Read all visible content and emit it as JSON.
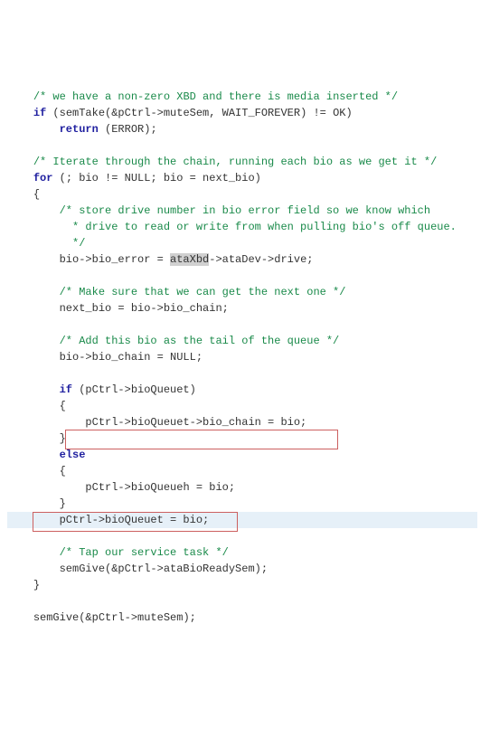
{
  "code": {
    "l1": "/* we have a non-zero XBD and there is media inserted */",
    "l2a": "if",
    "l2b": " (semTake(&pCtrl->muteSem, WAIT_FOREVER) != OK)",
    "l3a": "return",
    "l3b": " (ERROR);",
    "l4": "/* Iterate through the chain, running each bio as we get it */",
    "l5a": "for",
    "l5b": " (; bio != NULL; bio = next_bio)",
    "l6": "{",
    "l7": "/* store drive number in bio error field so we know which",
    "l8": " * drive to read or write from when pulling bio's off queue.",
    "l9": " */",
    "l10a": "bio->bio_error = ",
    "l10b": "ataXbd",
    "l10c": "->ataDev->drive;",
    "l11": "/* Make sure that we can get the next one */",
    "l12": "next_bio = bio->bio_chain;",
    "l13": "/* Add this bio as the tail of the queue */",
    "l14": "bio->bio_chain = NULL;",
    "l15a": "if",
    "l15b": " (pCtrl->bioQueuet)",
    "l16": "{",
    "l17": "pCtrl->bioQueuet->bio_chain = bio;",
    "l18": "}",
    "l19": "else",
    "l20": "{",
    "l21": "pCtrl->bioQueueh = bio;",
    "l22": "}",
    "l23": "pCtrl->bioQueuet = bio;",
    "l24": "/* Tap our service task */",
    "l25": "semGive(&pCtrl->ataBioReadySem);",
    "l26": "}",
    "l27": "semGive(&pCtrl->muteSem);"
  }
}
